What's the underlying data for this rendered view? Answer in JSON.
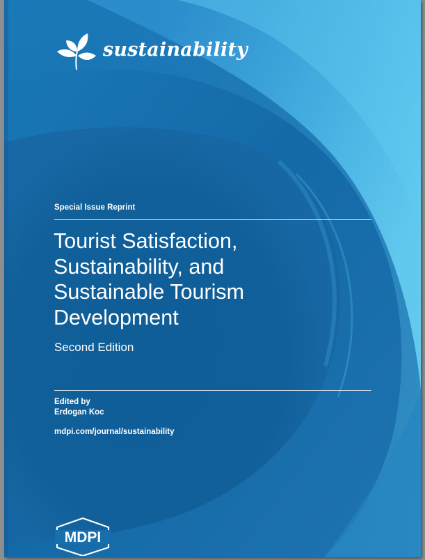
{
  "journal": {
    "name": "sustainability",
    "logo_icon": "leaf-sprout-icon"
  },
  "cover": {
    "series_label": "Special Issue Reprint",
    "title_lines": [
      "Tourist Satisfaction,",
      "Sustainability, and",
      "Sustainable Tourism",
      "Development"
    ],
    "edition": "Second Edition",
    "edited_by_label": "Edited by",
    "editor_name": "Erdogan Koc",
    "url": "mdpi.com/journal/sustainability"
  },
  "publisher": {
    "name": "MDPI"
  },
  "colors": {
    "cover_base": "#176fae",
    "cover_dark": "#0f5a92",
    "cover_light": "#58c3ec",
    "text": "#ffffff"
  }
}
